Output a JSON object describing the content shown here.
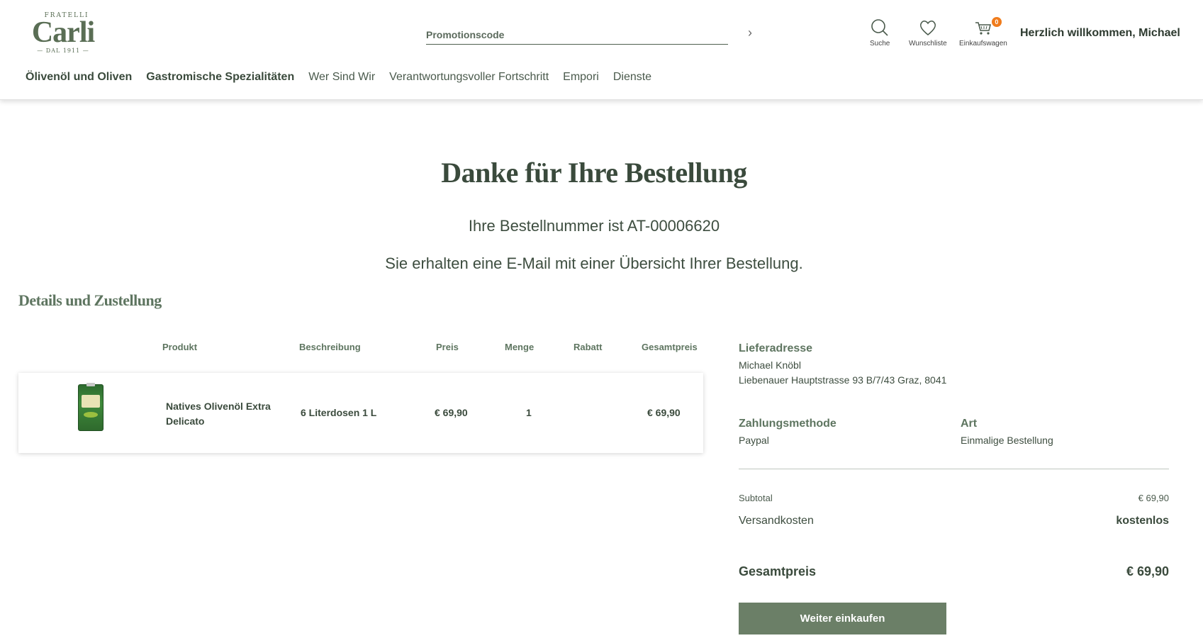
{
  "brand": {
    "top": "FRATELLI",
    "name": "Carli",
    "since": "— DAL 1911 —"
  },
  "header": {
    "promo_placeholder": "Promotionscode",
    "promo_arrow": "›",
    "search_label": "Suche",
    "wishlist_label": "Wunschliste",
    "cart_label": "Einkaufswagen",
    "cart_count": "0",
    "welcome": "Herzlich willkommen, Michael"
  },
  "nav": [
    {
      "label": "Ölivenöl und Oliven"
    },
    {
      "label": "Gastromische Spezialitäten"
    },
    {
      "label": "Wer Sind Wir"
    },
    {
      "label": "Verantwortungsvoller Fortschritt"
    },
    {
      "label": "Empori"
    },
    {
      "label": "Dienste"
    }
  ],
  "main": {
    "title": "Danke für Ihre Bestellung",
    "order_number": "Ihre Bestellnummer ist AT-00006620",
    "email_message": "Sie erhalten eine E-Mail mit einer Übersicht Ihrer Bestellung.",
    "section_title": "Details und Zustellung"
  },
  "table": {
    "headers": {
      "product": "Produkt",
      "description": "Beschreibung",
      "price": "Preis",
      "quantity": "Menge",
      "discount": "Rabatt",
      "total": "Gesamtpreis"
    },
    "rows": [
      {
        "product_line1": "Natives Olivenöl Extra",
        "product_line2": "Delicato",
        "description": "6 Literdosen 1 L",
        "price": "€ 69,90",
        "quantity": "1",
        "discount": "",
        "total": "€ 69,90"
      }
    ]
  },
  "sidebar": {
    "delivery_title": "Lieferadresse",
    "delivery_name": "Michael Knöbl",
    "delivery_address": "Liebenauer Hauptstrasse 93 B/7/43 Graz, 8041",
    "payment_title": "Zahlungsmethode",
    "payment_value": "Paypal",
    "type_title": "Art",
    "type_value": "Einmalige Bestellung",
    "subtotal_label": "Subtotal",
    "subtotal_value": "€ 69,90",
    "shipping_label": "Versandkosten",
    "shipping_value": "kostenlos",
    "total_label": "Gesamtpreis",
    "total_value": "€ 69,90",
    "continue_button": "Weiter einkaufen"
  },
  "colors": {
    "brand_green": "#5e7560",
    "button_green": "#6b7f67",
    "cart_badge": "#f07c1c"
  }
}
